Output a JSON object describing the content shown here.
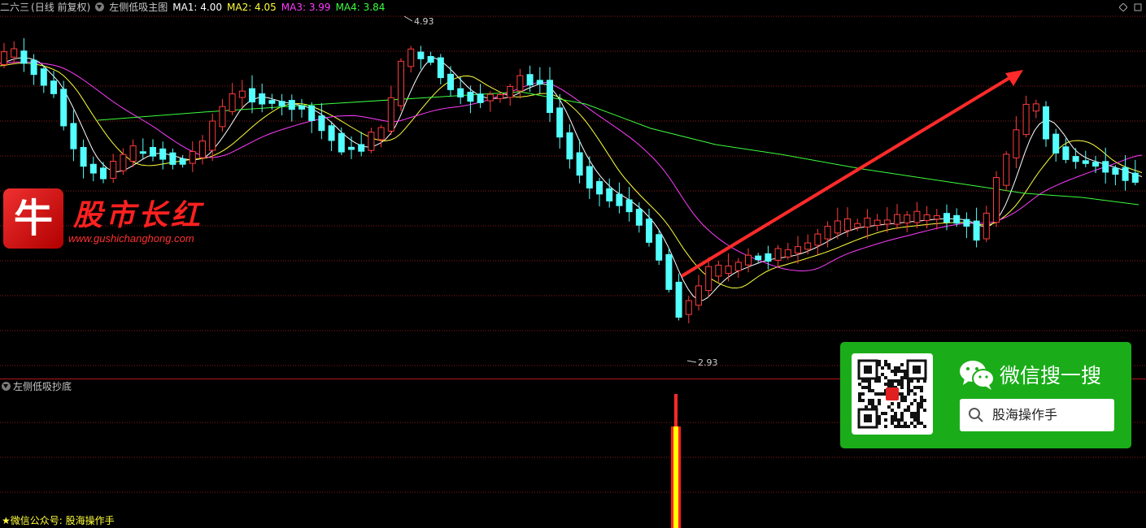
{
  "header": {
    "stock_name": "二六三",
    "period": "(日线 前复权)",
    "indicator_name": "左侧低吸主图",
    "ma": [
      {
        "label": "MA1: 4.00",
        "color": "#ffffff"
      },
      {
        "label": "MA2: 4.05",
        "color": "#ffff3c"
      },
      {
        "label": "MA3: 3.99",
        "color": "#ff3cff"
      },
      {
        "label": "MA4: 3.84",
        "color": "#3cff3c"
      }
    ],
    "corner_icon": "diamond-icon"
  },
  "main_chart": {
    "high_label": "4.93",
    "low_label": "2.93",
    "colors": {
      "up": "#ff3c3c",
      "down": "#54ffff",
      "ma1": "#ffffff",
      "ma2": "#ffff3c",
      "ma3": "#ff3cff",
      "ma4": "#3cff3c",
      "grid": "#8b1a1a",
      "arrow": "#ff2a2a"
    }
  },
  "sub_chart": {
    "title": "左侧低吸抄底",
    "signal_colors": {
      "outer": "#ff2020",
      "inner": "#ffff00"
    }
  },
  "footer": {
    "text": "★微信公众号: 股海操作手"
  },
  "logo": {
    "badge_char": "牛",
    "title": "股市长红",
    "url": "www.gushichanghong.com"
  },
  "wechat_card": {
    "title": "微信搜一搜",
    "search_text": "股海操作手",
    "icon": "wechat-icon",
    "search_icon": "search-icon"
  }
}
